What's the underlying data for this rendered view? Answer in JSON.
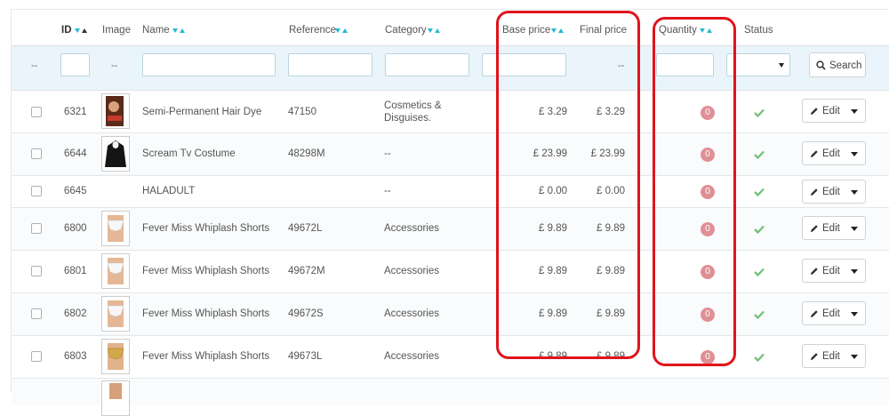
{
  "columns": {
    "id": "ID",
    "image": "Image",
    "name": "Name",
    "reference": "Reference",
    "category": "Category",
    "base_price": "Base price",
    "final_price": "Final price",
    "quantity": "Quantity",
    "status": "Status"
  },
  "filters": {
    "bulk_dash": "--",
    "image_dash": "--",
    "final_price_dash": "--",
    "search_label": "Search"
  },
  "rows": [
    {
      "id": "6321",
      "name": "Semi-Permanent Hair Dye",
      "reference": "47150",
      "category": "Cosmetics & Disguises.",
      "category_line1": "Cosmetics &",
      "category_line2": "Disguises.",
      "base_price": "£ 3.29",
      "final_price": "£ 3.29",
      "quantity": "0",
      "edit": "Edit"
    },
    {
      "id": "6644",
      "name": "Scream Tv Costume",
      "reference": "48298M",
      "category": "--",
      "base_price": "£ 23.99",
      "final_price": "£ 23.99",
      "quantity": "0",
      "edit": "Edit"
    },
    {
      "id": "6645",
      "name": "HALADULT",
      "reference": "",
      "category": "--",
      "base_price": "£ 0.00",
      "final_price": "£ 0.00",
      "quantity": "0",
      "edit": "Edit"
    },
    {
      "id": "6800",
      "name": "Fever Miss Whiplash Shorts",
      "reference": "49672L",
      "category": "Accessories",
      "base_price": "£ 9.89",
      "final_price": "£ 9.89",
      "quantity": "0",
      "edit": "Edit"
    },
    {
      "id": "6801",
      "name": "Fever Miss Whiplash Shorts",
      "reference": "49672M",
      "category": "Accessories",
      "base_price": "£ 9.89",
      "final_price": "£ 9.89",
      "quantity": "0",
      "edit": "Edit"
    },
    {
      "id": "6802",
      "name": "Fever Miss Whiplash Shorts",
      "reference": "49672S",
      "category": "Accessories",
      "base_price": "£ 9.89",
      "final_price": "£ 9.89",
      "quantity": "0",
      "edit": "Edit"
    },
    {
      "id": "6803",
      "name": "Fever Miss Whiplash Shorts",
      "reference": "49673L",
      "category": "Accessories",
      "base_price": "£ 9.89",
      "final_price": "£ 9.89",
      "quantity": "0",
      "edit": "Edit"
    }
  ],
  "colors": {
    "accent": "#25b9d7",
    "highlight": "#e0141c",
    "badge": "#e08f95",
    "status_ok": "#72c279",
    "filter_bg": "#eaf5fb"
  }
}
